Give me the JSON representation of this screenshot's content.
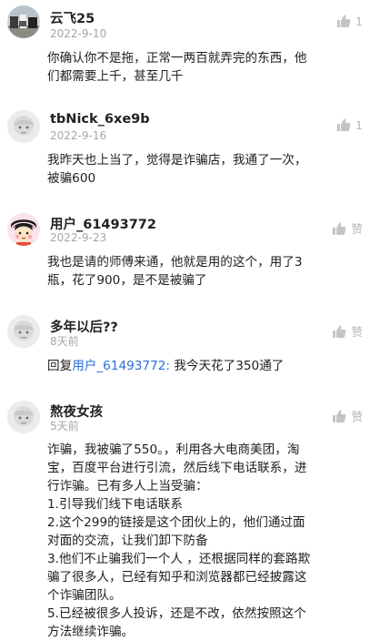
{
  "comments": [
    {
      "user": "云飞25",
      "date": "2022-9-10",
      "text": [
        "你确认你不是拖，正常一两百就弄完的东西，他",
        "们都需要上千，甚至几千"
      ],
      "likes": "1",
      "avatar": "photo"
    },
    {
      "user": "tbNick_6xe9b",
      "date": "2022-9-16",
      "text": [
        "我昨天也上当了，觉得是诈骗店，我通了一次，",
        "被骗600"
      ],
      "likes": "1",
      "avatar": "default"
    },
    {
      "user": "用户_61493772",
      "date": "2022-9-23",
      "text": [
        "我也是请的师傅来通，他就是用的这个，用了3",
        "瓶，花了900，是不是被骗了"
      ],
      "likes": "赞",
      "avatar": "cartoon"
    },
    {
      "user": "多年以后??",
      "date": "8天前",
      "reply_prefix": "回复",
      "reply_to": "用户_61493772:",
      "reply_text": " 我今天花了350通了",
      "likes": "赞",
      "avatar": "default"
    },
    {
      "user": "熬夜女孩",
      "date": "5天前",
      "text": [
        "诈骗，我被骗了550。，利用各大电商美团，淘",
        "宝，百度平台进行引流，然后线下电话联系，进",
        "行诈骗。已有多人上当受骗：",
        "1.引导我们线下电话联系",
        "2.这个299的链接是这个团伙上的，他们通过面",
        "对面的交流，让我们卸下防备",
        "3.他们不止骗我们一个人 ，还根据同样的套路欺",
        "骗了很多人，已经有知乎和浏览器都已经披露这",
        "个诈骗团队。",
        "5.已经被很多人投诉，还是不改，依然按照这个",
        "方法继续诈骗。"
      ],
      "likes": "赞",
      "avatar": "default"
    }
  ],
  "colors": {
    "link": "#2d6ed8",
    "date": "#a6a6a6",
    "like": "#b5b5b5"
  },
  "icons": {
    "like": "thumbs-up-icon"
  }
}
